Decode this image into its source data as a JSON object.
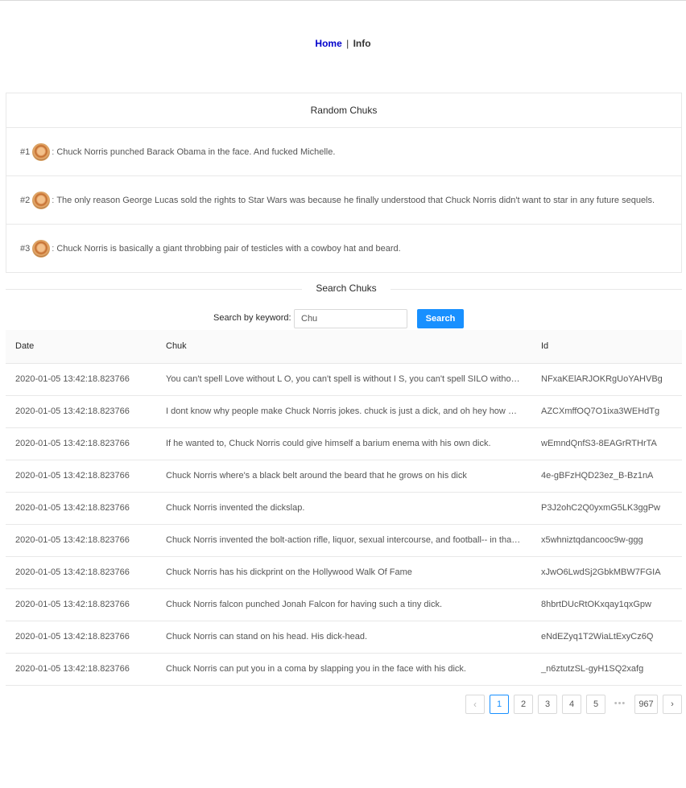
{
  "nav": {
    "home": "Home",
    "separator": "|",
    "info": "Info"
  },
  "random": {
    "title": "Random Chuks",
    "items": [
      {
        "num": "#1",
        "text": "Chuck Norris punched Barack Obama in the face. And fucked Michelle."
      },
      {
        "num": "#2",
        "text": "The only reason George Lucas sold the rights to Star Wars was because he finally understood that Chuck Norris didn't want to star in any future sequels."
      },
      {
        "num": "#3",
        "text": "Chuck Norris is basically a giant throbbing pair of testicles with a cowboy hat and beard."
      }
    ]
  },
  "search": {
    "section_title": "Search Chuks",
    "label": "Search by keyword",
    "value": "Chu",
    "button": "Search"
  },
  "table": {
    "headers": {
      "date": "Date",
      "chuk": "Chuk",
      "id": "Id"
    },
    "rows": [
      {
        "date": "2020-01-05 13:42:18.823766",
        "chuk": "You can't spell Love without L O, you can't spell is without I S, you can't spell SILO without LOIS. You can't spell Chuck Norris without...",
        "id": "NFxaKElARJOKRgUoYAHVBg"
      },
      {
        "date": "2020-01-05 13:42:18.823766",
        "chuk": "I dont know why people make Chuck Norris jokes. chuck is just a dick, and oh hey how did you get in my house",
        "id": "AZCXmffOQ7O1ixa3WEHdTg"
      },
      {
        "date": "2020-01-05 13:42:18.823766",
        "chuk": "If he wanted to, Chuck Norris could give himself a barium enema with his own dick.",
        "id": "wEmndQnfS3-8EAGrRTHrTA"
      },
      {
        "date": "2020-01-05 13:42:18.823766",
        "chuk": "Chuck Norris where's a black belt around the beard that he grows on his dick",
        "id": "4e-gBFzHQD23ez_B-Bz1nA"
      },
      {
        "date": "2020-01-05 13:42:18.823766",
        "chuk": "Chuck Norris invented the dickslap.",
        "id": "P3J2ohC2Q0yxmG5LK3ggPw"
      },
      {
        "date": "2020-01-05 13:42:18.823766",
        "chuk": "Chuck Norris invented the bolt-action rifle, liquor, sexual intercourse, and football-- in that order.",
        "id": "x5whniztqdancooc9w-ggg"
      },
      {
        "date": "2020-01-05 13:42:18.823766",
        "chuk": "Chuck Norris has his dickprint on the Hollywood Walk Of Fame",
        "id": "xJwO6LwdSj2GbkMBW7FGIA"
      },
      {
        "date": "2020-01-05 13:42:18.823766",
        "chuk": "Chuck Norris falcon punched Jonah Falcon for having such a tiny dick.",
        "id": "8hbrtDUcRtOKxqay1qxGpw"
      },
      {
        "date": "2020-01-05 13:42:18.823766",
        "chuk": "Chuck Norris can stand on his head. His dick-head.",
        "id": "eNdEZyq1T2WiaLtExyCz6Q"
      },
      {
        "date": "2020-01-05 13:42:18.823766",
        "chuk": "Chuck Norris can put you in a coma by slapping you in the face with his dick.",
        "id": "_n6ztutzSL-gyH1SQ2xafg"
      }
    ]
  },
  "pagination": {
    "prev": "‹",
    "pages": [
      "1",
      "2",
      "3",
      "4",
      "5"
    ],
    "ellipsis": "•••",
    "last": "967",
    "next": "›",
    "current": "1"
  },
  "colors": {
    "primary": "#1890ff",
    "border": "#e8e8e8",
    "header_bg": "#fafafa"
  },
  "icons": {
    "avatar": "chuck-avatar-icon",
    "prev": "chevron-left-icon",
    "next": "chevron-right-icon"
  }
}
